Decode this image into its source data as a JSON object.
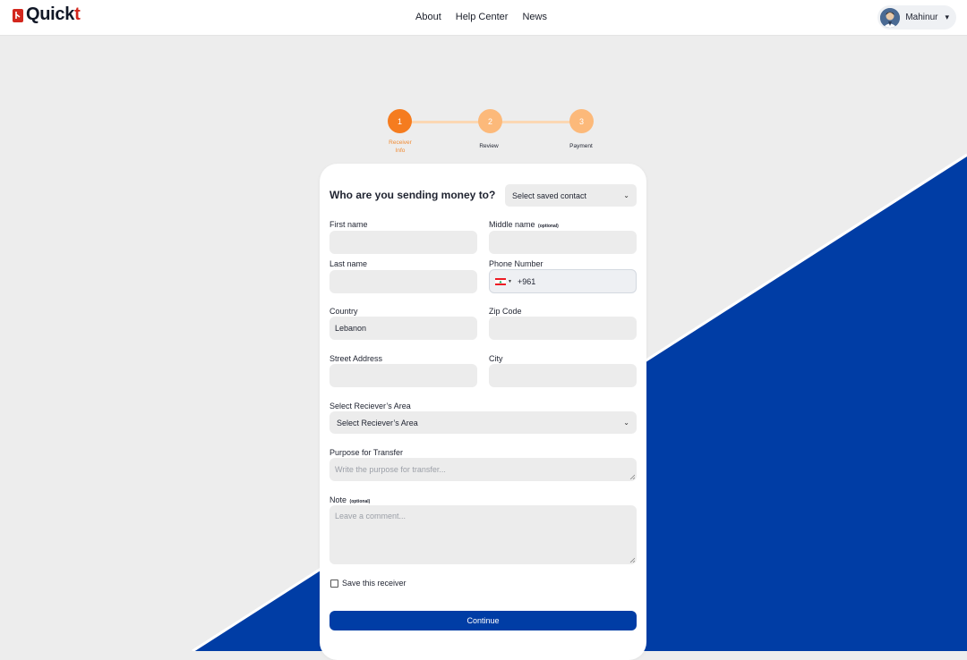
{
  "brand": {
    "logo_text_main": "Quick",
    "logo_text_accent": "t"
  },
  "nav": {
    "items": [
      "About",
      "Help Center",
      "News"
    ]
  },
  "user": {
    "name": "Mahinur",
    "caret": "▾"
  },
  "stepper": {
    "steps": [
      {
        "number": "1",
        "label_line1": "Receiver",
        "label_line2": "Info",
        "state": "active"
      },
      {
        "number": "2",
        "label_line1": "Review",
        "label_line2": "",
        "state": "pending"
      },
      {
        "number": "3",
        "label_line1": "Payment",
        "label_line2": "",
        "state": "pending"
      }
    ]
  },
  "form": {
    "heading": "Who are you sending money to?",
    "saved_contact": {
      "value": "Select saved contact"
    },
    "first_name": {
      "label": "First name",
      "value": ""
    },
    "middle_name": {
      "label": "Middle name",
      "optional": "(optional)",
      "value": ""
    },
    "last_name": {
      "label": "Last name",
      "value": ""
    },
    "phone": {
      "label": "Phone Number",
      "prefix": "+961",
      "country_flag": "lebanon-flag"
    },
    "country": {
      "label": "Country",
      "value": "Lebanon"
    },
    "zip": {
      "label": "Zip Code",
      "value": ""
    },
    "street": {
      "label": "Street Address",
      "value": ""
    },
    "city": {
      "label": "City",
      "value": ""
    },
    "area": {
      "label": "Select Reciever’s Area",
      "value": "Select Reciever’s Area"
    },
    "purpose": {
      "label": "Purpose for Transfer",
      "placeholder": "Write the purpose for transfer..."
    },
    "note": {
      "label": "Note",
      "optional": "(optional)",
      "placeholder": "Leave a comment..."
    },
    "save_receiver": {
      "label": "Save this receiver",
      "checked": false
    },
    "continue_label": "Continue"
  },
  "colors": {
    "accent_orange": "#f57c1f",
    "orange_light": "#fcb97a",
    "primary_blue": "#003da5",
    "brand_red": "#d3271d"
  }
}
